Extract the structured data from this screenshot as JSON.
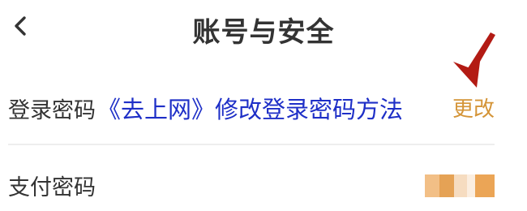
{
  "header": {
    "back_icon": "chevron-left-icon",
    "title": "账号与安全"
  },
  "rows": {
    "login_password": {
      "label": "登录密码",
      "action_label": "更改",
      "action_color": "#d49437"
    },
    "payment_password": {
      "label": "支付密码",
      "toggle_icon": "pixelated-toggle"
    }
  },
  "overlay": {
    "caption": "《去上网》修改登录密码方法",
    "color": "#1e2fc7"
  },
  "annotation": {
    "icon": "red-arrow-down-icon",
    "color": "#b31b14"
  }
}
